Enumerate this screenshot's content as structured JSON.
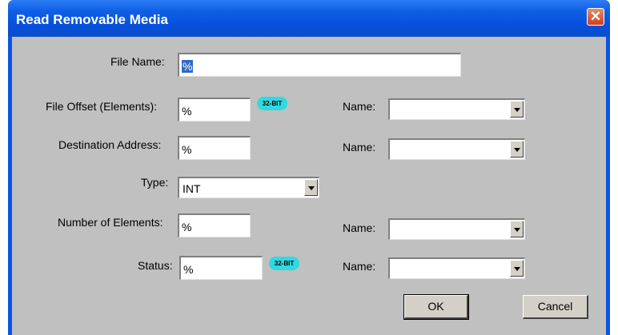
{
  "window": {
    "title": "Read Removable Media",
    "close_icon": "close-icon"
  },
  "labels": {
    "file_name": "File Name:",
    "file_offset": "File Offset (Elements):",
    "destination_address": "Destination Address:",
    "type": "Type:",
    "number_of_elements": "Number of Elements:",
    "status": "Status:",
    "name": "Name:"
  },
  "fields": {
    "file_name": "%",
    "file_offset": "%",
    "destination_address": "%",
    "number_of_elements": "%",
    "status": "%"
  },
  "type_select": {
    "value": "INT"
  },
  "name_selects": [
    "",
    "",
    "",
    ""
  ],
  "badges": {
    "file_offset": "32-BIT",
    "status": "32-BIT"
  },
  "buttons": {
    "ok": "OK",
    "cancel": "Cancel"
  },
  "colors": {
    "titlebar": "#0a55e3",
    "client": "#c0c0c0",
    "badge": "#2fd9e0",
    "selection": "#316ac5"
  }
}
